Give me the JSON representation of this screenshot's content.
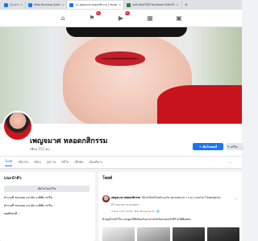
{
  "browser": {
    "tabs": [
      {
        "label": "(1) ค่าฯ",
        "color": "#1877f2"
      },
      {
        "label": "Meta Business Suite",
        "color": "#1877f2"
      },
      {
        "label": "(1) เพญจมาศ หลอดกสิกรรม | Faceb",
        "color": "#1877f2"
      },
      {
        "label": "ลบป้ายลิงก์ไม่ได้ Facebook ถ้าอีกครั้ง",
        "color": "#2e7d32"
      }
    ],
    "new_tab": "+"
  },
  "fbnav": {
    "icons": [
      {
        "name": "home-icon",
        "glyph": "⌂",
        "badge": ""
      },
      {
        "name": "flag-icon",
        "glyph": "⚑",
        "badge": "9+"
      },
      {
        "name": "video-icon",
        "glyph": "▶",
        "badge": "9+"
      },
      {
        "name": "marketplace-icon",
        "glyph": "▦",
        "badge": ""
      },
      {
        "name": "gaming-icon",
        "glyph": "▣",
        "badge": ""
      }
    ]
  },
  "profile": {
    "name": "เพญจมาศ หลอดกสิกรรม",
    "friends": "เพื่อน 152 คน",
    "add_story_label": "+ เพิ่มในสตอรี่",
    "edit_profile_label": "✎ แก้ไข"
  },
  "profile_tabs": [
    {
      "label": "โพสต์",
      "active": true
    },
    {
      "label": "เกี่ยวกับ",
      "active": false
    },
    {
      "label": "เพื่อน",
      "active": false
    },
    {
      "label": "รูปภาพ",
      "active": false
    },
    {
      "label": "วิดีโอ",
      "active": false
    },
    {
      "label": "เช็คอิน",
      "active": false
    },
    {
      "label": "เพิ่มเติม ▾",
      "active": false
    }
  ],
  "profile_tabs_more": "···",
  "intro": {
    "title": "แนะนำตัว",
    "edit_bio_label": "เพิ่มไบโอ/แก้ไข",
    "items": [
      "ทำงานที่ ตลาดนม แมวนิล แปซิฟิก ท่าจีน",
      "ทำงานที่ ตลาดนม แมวนิล แปซิฟิก ท่าจีน",
      "เคยศึกษาที่ ..."
    ]
  },
  "posts": {
    "title": "โพสต์",
    "items": [
      {
        "author": "เพญจมาศ หลอดกสิกรรม",
        "action": "ได้แชร์ลิงก์ด้วยตัวเองกับ",
        "target": "ชุมชนตลาด ฯ และ Luecha Tihaenghan",
        "sub": "ที่ ร้านอาหาร ตามรอยกา",
        "meta": "4 เม.ย. เวลา 10:33 · Ban Nong Kuruk · 🌐",
        "text": "ทำบุญในวันไว้ใน และดูแลให้พร้อมกับอาหารครับกับครอบครัวที่ร้านได้ดีเลยค่ะ",
        "more": "···"
      }
    ]
  },
  "colors": {
    "accent": "#1877f2",
    "badge": "#e41e3f",
    "cover_shirt": "#c8141d"
  }
}
